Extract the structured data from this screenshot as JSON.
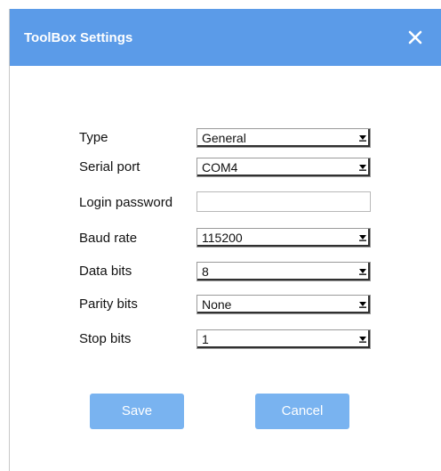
{
  "dialog": {
    "title": "ToolBox Settings",
    "close_icon": "close-icon"
  },
  "fields": {
    "type": {
      "label": "Type",
      "value": "General"
    },
    "serial_port": {
      "label": "Serial port",
      "value": "COM4"
    },
    "login_password": {
      "label": "Login password",
      "value": ""
    },
    "baud_rate": {
      "label": "Baud rate",
      "value": "115200"
    },
    "data_bits": {
      "label": "Data bits",
      "value": "8"
    },
    "parity_bits": {
      "label": "Parity bits",
      "value": "None"
    },
    "stop_bits": {
      "label": "Stop bits",
      "value": "1"
    }
  },
  "buttons": {
    "save_label": "Save",
    "cancel_label": "Cancel"
  },
  "colors": {
    "titlebar": "#5b9be8",
    "button": "#79b3f0"
  }
}
